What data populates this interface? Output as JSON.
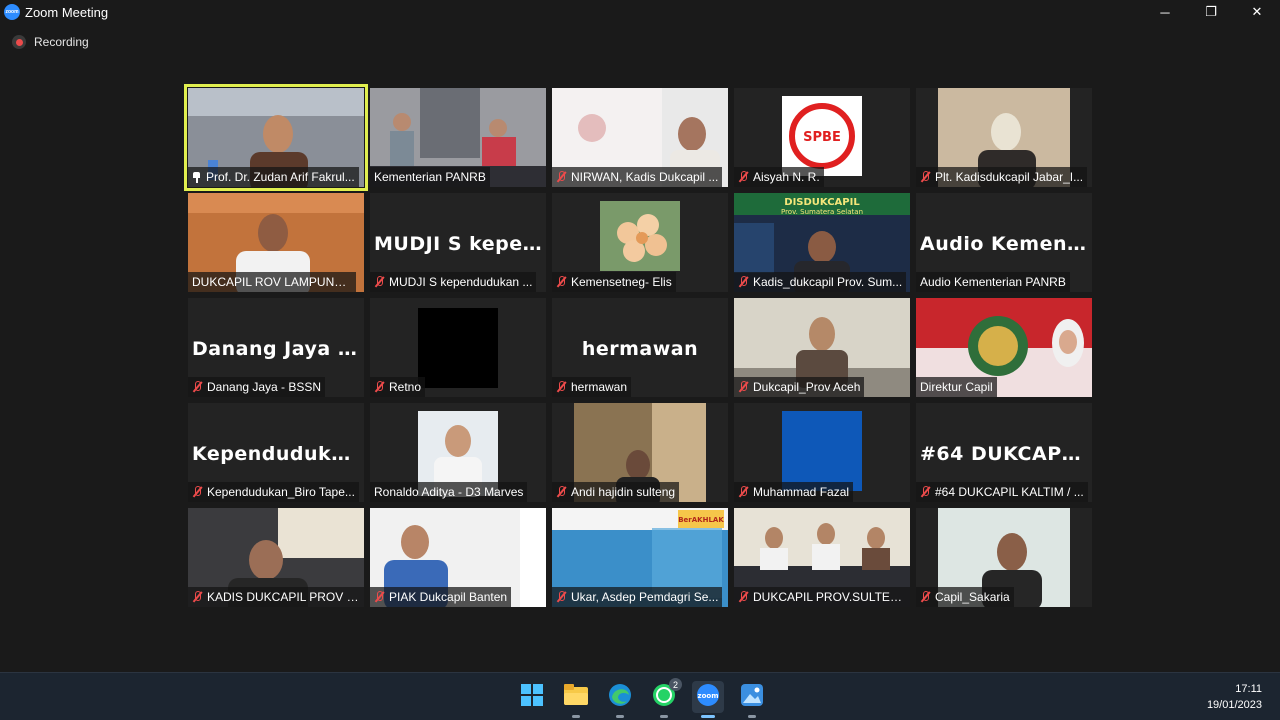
{
  "window": {
    "title": "Zoom Meeting",
    "minimize": "─",
    "restore": "❐",
    "close": "✕"
  },
  "recording": {
    "label": "Recording"
  },
  "participants": [
    {
      "id": "p1",
      "name": "Prof. Dr. Zudan Arif Fakrul...",
      "video": "camera",
      "pinned": true,
      "active": true
    },
    {
      "id": "p2",
      "name": "Kementerian PANRB",
      "video": "camera",
      "muted": false
    },
    {
      "id": "p3",
      "name": "NIRWAN, Kadis Dukcapil ...",
      "video": "camera",
      "muted": true
    },
    {
      "id": "p4",
      "name": "Aisyah N. R.",
      "video": "logo",
      "logo_text": "SPBE",
      "muted": true
    },
    {
      "id": "p5",
      "name": "Plt. Kadisdukcapil Jabar_I...",
      "video": "camera",
      "muted": true
    },
    {
      "id": "p6",
      "name": "DUKCAPIL ROV LAMPUNG, ...",
      "video": "camera",
      "muted": false
    },
    {
      "id": "p7",
      "name": "MUDJI S kependudukan ...",
      "video": "none",
      "display": "MUDJI S kepen...",
      "muted": true
    },
    {
      "id": "p8",
      "name": "Kemensetneg- Elis",
      "video": "flower",
      "muted": true
    },
    {
      "id": "p9",
      "name": "Kadis_dukcapil Prov. Sum...",
      "video": "banner",
      "banner_title": "DISDUKCAPIL",
      "banner_sub": "Prov. Sumatera Selatan",
      "muted": true
    },
    {
      "id": "p10",
      "name": "Audio Kementerian PANRB",
      "video": "none",
      "display": "Audio Kemente...",
      "muted": false
    },
    {
      "id": "p11",
      "name": "Danang Jaya - BSSN",
      "video": "none",
      "display": "Danang Jaya -...",
      "muted": true
    },
    {
      "id": "p12",
      "name": "Retno",
      "video": "black",
      "muted": true
    },
    {
      "id": "p13",
      "name": "hermawan",
      "video": "none",
      "display": "hermawan",
      "muted": true
    },
    {
      "id": "p14",
      "name": "Dukcapil_Prov Aceh",
      "video": "camera",
      "muted": true
    },
    {
      "id": "p15",
      "name": "Direktur Capil",
      "video": "emblem",
      "muted": false
    },
    {
      "id": "p16",
      "name": "Kependudukan_Biro Tape...",
      "video": "none",
      "display": "Kependudukan_...",
      "muted": true
    },
    {
      "id": "p17",
      "name": "Ronaldo Aditya - D3 Marves",
      "video": "portrait",
      "muted": false
    },
    {
      "id": "p18",
      "name": "Andi hajidin sulteng",
      "video": "camera",
      "muted": true
    },
    {
      "id": "p19",
      "name": "Muhammad Fazal",
      "video": "blue",
      "muted": true
    },
    {
      "id": "p20",
      "name": "#64 DUKCAPIL KALTIM / ...",
      "video": "none",
      "display": "#64 DUKCAPIL...",
      "muted": true
    },
    {
      "id": "p21",
      "name": "KADIS DUKCAPIL PROV S...",
      "video": "camera",
      "muted": true
    },
    {
      "id": "p22",
      "name": "PIAK Dukcapil Banten",
      "video": "camera",
      "muted": true
    },
    {
      "id": "p23",
      "name": "Ukar, Asdep Pemdagri Se...",
      "video": "slide",
      "slide_text": "Ber AKHLAK",
      "muted": true
    },
    {
      "id": "p24",
      "name": "DUKCAPIL PROV.SULTENG",
      "video": "camera",
      "muted": true
    },
    {
      "id": "p25",
      "name": "Capil_Sakaria",
      "video": "camera",
      "muted": true
    }
  ],
  "taskbar": {
    "apps": [
      {
        "name": "start",
        "label": "Start"
      },
      {
        "name": "file-explorer",
        "label": "File Explorer"
      },
      {
        "name": "edge",
        "label": "Microsoft Edge"
      },
      {
        "name": "whatsapp",
        "label": "WhatsApp",
        "badge": "2"
      },
      {
        "name": "zoom",
        "label": "Zoom",
        "active": true
      },
      {
        "name": "photos",
        "label": "Photos"
      }
    ],
    "time": "17:11",
    "date": "19/01/2023"
  },
  "colors": {
    "active_border": "#e1ef4f",
    "muted_red": "#ec4b4b",
    "zoom_blue": "#2d8cff"
  }
}
